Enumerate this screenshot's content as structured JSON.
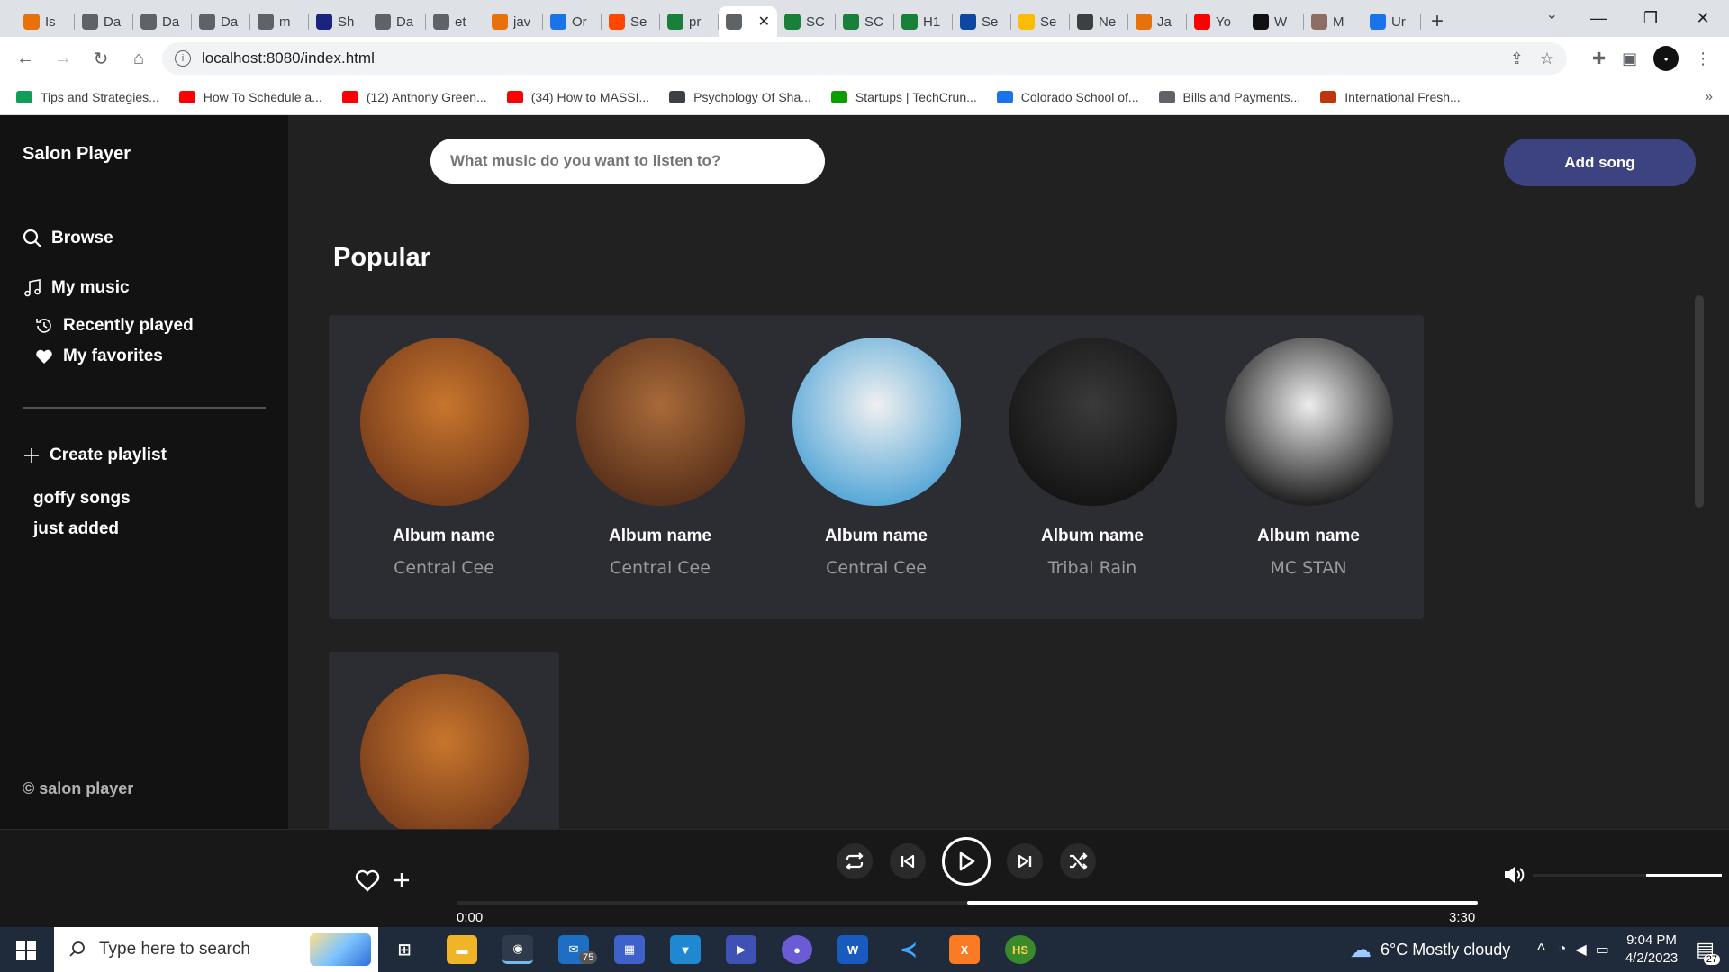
{
  "browser": {
    "tabs": [
      {
        "title": "Is",
        "color": "#e8710a"
      },
      {
        "title": "Da",
        "color": "#5f6368"
      },
      {
        "title": "Da",
        "color": "#5f6368"
      },
      {
        "title": "Da",
        "color": "#5f6368"
      },
      {
        "title": "m",
        "color": "#5f6368"
      },
      {
        "title": "Sh",
        "color": "#1a237e"
      },
      {
        "title": "Da",
        "color": "#5f6368"
      },
      {
        "title": "et",
        "color": "#5f6368"
      },
      {
        "title": "jav",
        "color": "#e8710a"
      },
      {
        "title": "Or",
        "color": "#1a73e8"
      },
      {
        "title": "Se",
        "color": "#ff4500"
      },
      {
        "title": "pr",
        "color": "#188038"
      },
      {
        "title": "",
        "color": "#5f6368",
        "active": true
      },
      {
        "title": "SC",
        "color": "#188038"
      },
      {
        "title": "SC",
        "color": "#188038"
      },
      {
        "title": "H1",
        "color": "#188038"
      },
      {
        "title": "Se",
        "color": "#0d47a1"
      },
      {
        "title": "Se",
        "color": "#fbbc04"
      },
      {
        "title": "Ne",
        "color": "#3c4043"
      },
      {
        "title": "Ja",
        "color": "#e8710a"
      },
      {
        "title": "Yo",
        "color": "#ff0000"
      },
      {
        "title": "W",
        "color": "#111111"
      },
      {
        "title": "M",
        "color": "#8d6e63"
      },
      {
        "title": "Ur",
        "color": "#1a73e8"
      }
    ],
    "url": "localhost:8080/index.html",
    "bookmarks": [
      {
        "label": "Tips and Strategies...",
        "color": "#0f9d58"
      },
      {
        "label": "How To Schedule a...",
        "color": "#ff0000"
      },
      {
        "label": "(12) Anthony Green...",
        "color": "#ff0000"
      },
      {
        "label": "(34) How to MASSI...",
        "color": "#ff0000"
      },
      {
        "label": "Psychology Of Sha...",
        "color": "#3c4043"
      },
      {
        "label": "Startups | TechCrun...",
        "color": "#0a9e01"
      },
      {
        "label": "Colorado School of...",
        "color": "#1a73e8"
      },
      {
        "label": "Bills and Payments...",
        "color": "#5f6368"
      },
      {
        "label": "International Fresh...",
        "color": "#bf360c"
      }
    ]
  },
  "app": {
    "brand": "Salon Player",
    "nav": {
      "browse": "Browse",
      "my_music": "My music",
      "recently_played": "Recently played",
      "my_favorites": "My favorites",
      "create_playlist": "Create playlist"
    },
    "playlists": [
      "goffy songs",
      "just added"
    ],
    "copyright": "© salon player",
    "search_placeholder": "What music do you want to listen to?",
    "add_song": "Add song",
    "section_title": "Popular",
    "albums": [
      {
        "name": "Album name",
        "artist": "Central Cee",
        "palette": [
          "#c8762d",
          "#7a3e1c"
        ]
      },
      {
        "name": "Album name",
        "artist": "Central Cee",
        "palette": [
          "#a86a3a",
          "#5b321b"
        ]
      },
      {
        "name": "Album name",
        "artist": "Central Cee",
        "palette": [
          "#f0f0f0",
          "#5aa9d8"
        ]
      },
      {
        "name": "Album name",
        "artist": "Tribal Rain",
        "palette": [
          "#3a3a3a",
          "#151515"
        ]
      },
      {
        "name": "Album name",
        "artist": "MC STAN",
        "palette": [
          "#eeeeee",
          "#222222"
        ]
      },
      {
        "name": "",
        "artist": "",
        "palette": [
          "#c8762d",
          "#7a3e1c"
        ]
      }
    ]
  },
  "player": {
    "current_time": "0:00",
    "duration": "3:30",
    "progress_fraction": 0.5,
    "volume_fraction": 0.4
  },
  "taskbar": {
    "search_placeholder": "Type here to search",
    "mail_badge": "75",
    "weather": "6°C  Mostly cloudy",
    "time": "9:04 PM",
    "date": "4/2/2023",
    "notification_count": "27"
  }
}
